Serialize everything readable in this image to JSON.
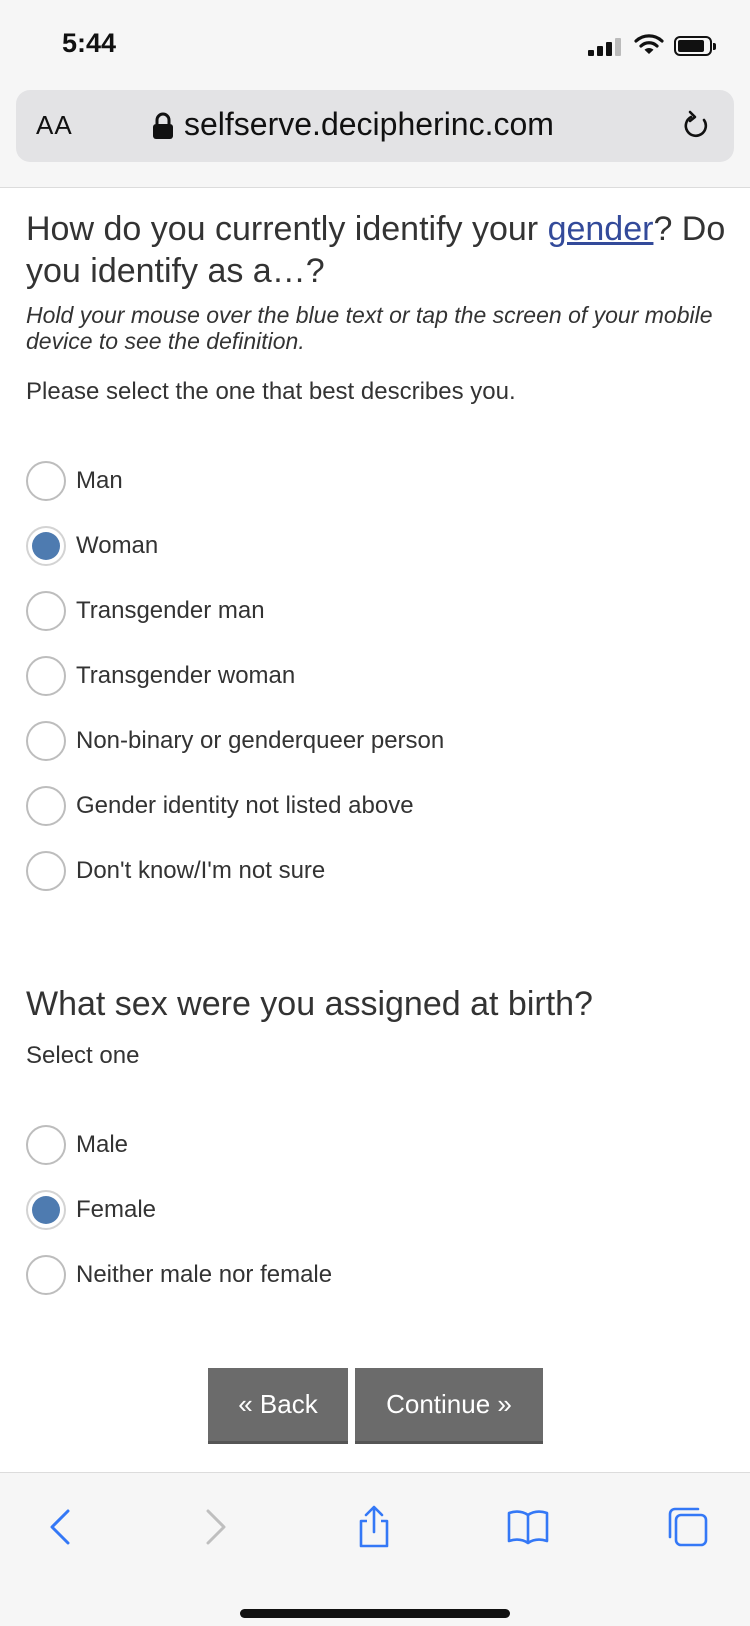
{
  "status_bar": {
    "time": "5:44"
  },
  "browser": {
    "text_size_label": "AA",
    "url": "selfserve.decipherinc.com"
  },
  "question1": {
    "title_before": "How do you currently identify your ",
    "title_term": "gender",
    "title_after": "? Do you identify as a…?",
    "hint": "Hold your mouse over the blue text or tap the screen of your mobile device to see the definition.",
    "instruction": "Please select the one that best describes you.",
    "options": [
      {
        "label": "Man",
        "selected": false
      },
      {
        "label": "Woman",
        "selected": true
      },
      {
        "label": "Transgender man",
        "selected": false
      },
      {
        "label": "Transgender woman",
        "selected": false
      },
      {
        "label": "Non-binary or genderqueer person",
        "selected": false
      },
      {
        "label": "Gender identity not listed above",
        "selected": false
      },
      {
        "label": "Don't know/I'm not sure",
        "selected": false
      }
    ]
  },
  "question2": {
    "title": "What sex were you assigned at birth?",
    "instruction": "Select one",
    "options": [
      {
        "label": "Male",
        "selected": false
      },
      {
        "label": "Female",
        "selected": true
      },
      {
        "label": "Neither male nor female",
        "selected": false
      }
    ]
  },
  "buttons": {
    "back": "« Back",
    "continue": "Continue »"
  },
  "toolbar": {
    "icons": [
      "back-icon",
      "forward-icon",
      "share-icon",
      "bookmarks-icon",
      "tabs-icon"
    ]
  },
  "colors": {
    "accent": "#4e7bb0",
    "term_link": "#334a9a",
    "button": "#6b6b6b"
  }
}
